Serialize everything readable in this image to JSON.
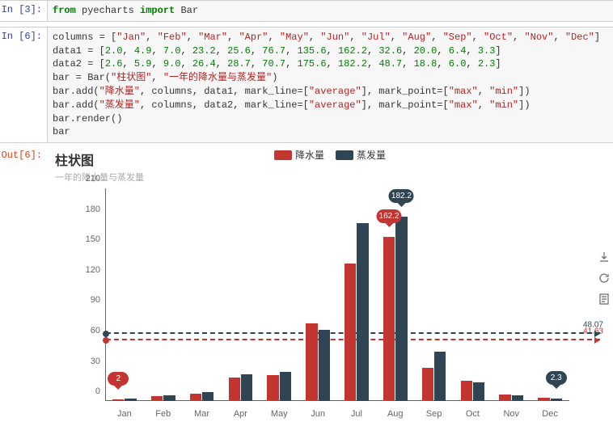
{
  "cells": {
    "in3": {
      "prompt": "In [3]:",
      "code_html": "<span class='kw'>from</span> pyecharts <span class='kw'>import</span> Bar"
    },
    "in6": {
      "prompt": "In [6]:",
      "code_html": "columns = [<span class='str'>\"Jan\"</span>, <span class='str'>\"Feb\"</span>, <span class='str'>\"Mar\"</span>, <span class='str'>\"Apr\"</span>, <span class='str'>\"May\"</span>, <span class='str'>\"Jun\"</span>, <span class='str'>\"Jul\"</span>, <span class='str'>\"Aug\"</span>, <span class='str'>\"Sep\"</span>, <span class='str'>\"Oct\"</span>, <span class='str'>\"Nov\"</span>, <span class='str'>\"Dec\"</span>]\ndata1 = [<span class='num'>2.0</span>, <span class='num'>4.9</span>, <span class='num'>7.0</span>, <span class='num'>23.2</span>, <span class='num'>25.6</span>, <span class='num'>76.7</span>, <span class='num'>135.6</span>, <span class='num'>162.2</span>, <span class='num'>32.6</span>, <span class='num'>20.0</span>, <span class='num'>6.4</span>, <span class='num'>3.3</span>]\ndata2 = [<span class='num'>2.6</span>, <span class='num'>5.9</span>, <span class='num'>9.0</span>, <span class='num'>26.4</span>, <span class='num'>28.7</span>, <span class='num'>70.7</span>, <span class='num'>175.6</span>, <span class='num'>182.2</span>, <span class='num'>48.7</span>, <span class='num'>18.8</span>, <span class='num'>6.0</span>, <span class='num'>2.3</span>]\nbar = Bar(<span class='str'>\"柱状图\"</span>, <span class='str'>\"一年的降水量与蒸发量\"</span>)\nbar.add(<span class='str'>\"降水量\"</span>, columns, data1, mark_line=[<span class='str'>\"average\"</span>], mark_point=[<span class='str'>\"max\"</span>, <span class='str'>\"min\"</span>])\nbar.add(<span class='str'>\"蒸发量\"</span>, columns, data2, mark_line=[<span class='str'>\"average\"</span>], mark_point=[<span class='str'>\"max\"</span>, <span class='str'>\"min\"</span>])\nbar.render()\nbar"
    },
    "out6": {
      "prompt": "Out[6]:"
    }
  },
  "chart": {
    "title": "柱状图",
    "subtitle": "一年的降水量与蒸发量",
    "legend": [
      {
        "name": "降水量",
        "color": "#c23531"
      },
      {
        "name": "蒸发量",
        "color": "#2f4554"
      }
    ],
    "yticks": [
      0,
      30,
      60,
      90,
      120,
      150,
      180,
      210
    ],
    "ymax": 210,
    "avg1": {
      "value": 41.63,
      "label": "41.63",
      "color": "#c23531"
    },
    "avg2": {
      "value": 48.07,
      "label": "48.07",
      "color": "#2f4554"
    },
    "markpoints": {
      "s1max": {
        "cat": "Aug",
        "series": 0,
        "value": 162.2,
        "label": "162.2",
        "color": "#c23531"
      },
      "s1min": {
        "cat": "Jan",
        "series": 0,
        "value": 2.0,
        "label": "2",
        "color": "#c23531"
      },
      "s2max": {
        "cat": "Aug",
        "series": 1,
        "value": 182.2,
        "label": "182.2",
        "color": "#2f4554"
      },
      "s2min": {
        "cat": "Dec",
        "series": 1,
        "value": 2.3,
        "label": "2.3",
        "color": "#2f4554"
      }
    },
    "toolbox": [
      "download",
      "refresh",
      "dataview"
    ]
  },
  "chart_data": {
    "type": "bar",
    "title": "柱状图",
    "subtitle": "一年的降水量与蒸发量",
    "categories": [
      "Jan",
      "Feb",
      "Mar",
      "Apr",
      "May",
      "Jun",
      "Jul",
      "Aug",
      "Sep",
      "Oct",
      "Nov",
      "Dec"
    ],
    "series": [
      {
        "name": "降水量",
        "color": "#c23531",
        "values": [
          2.0,
          4.9,
          7.0,
          23.2,
          25.6,
          76.7,
          135.6,
          162.2,
          32.6,
          20.0,
          6.4,
          3.3
        ]
      },
      {
        "name": "蒸发量",
        "color": "#2f4554",
        "values": [
          2.6,
          5.9,
          9.0,
          26.4,
          28.7,
          70.7,
          175.6,
          182.2,
          48.7,
          18.8,
          6.0,
          2.3
        ]
      }
    ],
    "xlabel": "",
    "ylabel": "",
    "ylim": [
      0,
      210
    ]
  }
}
